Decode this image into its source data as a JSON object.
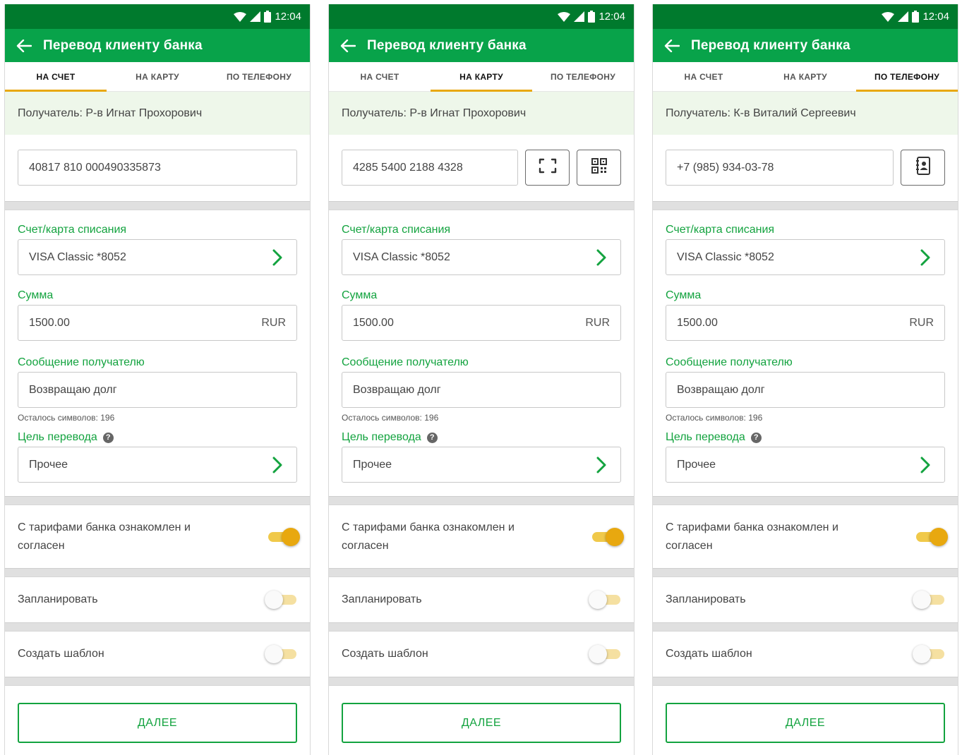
{
  "statusbar": {
    "time": "12:04"
  },
  "appbar": {
    "title": "Перевод клиенту банка"
  },
  "tabs": [
    "НА СЧЕТ",
    "НА КАРТУ",
    "ПО ТЕЛЕФОНУ"
  ],
  "form": {
    "account_label": "Счет/карта списания",
    "account_value": "VISA Classic *8052",
    "amount_label": "Сумма",
    "amount_value": "1500.00",
    "currency": "RUR",
    "message_label": "Сообщение получателю",
    "message_value": "Возвращаю долг",
    "chars_left": "Осталось символов: 196",
    "purpose_label": "Цель перевода",
    "purpose_help": "?",
    "purpose_value": "Прочее"
  },
  "toggles": {
    "tariff": {
      "label": "С тарифами банка ознакомлен и согласен",
      "on": true
    },
    "schedule": {
      "label": "Запланировать",
      "on": false
    },
    "template": {
      "label": "Создать шаблон",
      "on": false
    }
  },
  "next_button": "ДАЛЕЕ",
  "screens": [
    {
      "active_tab": 0,
      "recipient": "Получатель: Р-в Игнат Прохорович",
      "input_value": "40817 810 000490335873",
      "extra_buttons": []
    },
    {
      "active_tab": 1,
      "recipient": "Получатель: Р-в Игнат Прохорович",
      "input_value": "4285 5400 2188 4328",
      "extra_buttons": [
        "scan-card-icon",
        "qr-code-icon"
      ]
    },
    {
      "active_tab": 2,
      "recipient": "Получатель: К-в Виталий Сергеевич",
      "input_value": "+7 (985) 934-03-78",
      "extra_buttons": [
        "contacts-icon"
      ]
    }
  ],
  "colors": {
    "statusbar": "#007a2d",
    "appbar": "#08a34a",
    "accent_green": "#13a33f",
    "tab_indicator": "#e8a80f",
    "toggle_on": "#e8a80f",
    "recipient_bg": "#eef7ea"
  }
}
